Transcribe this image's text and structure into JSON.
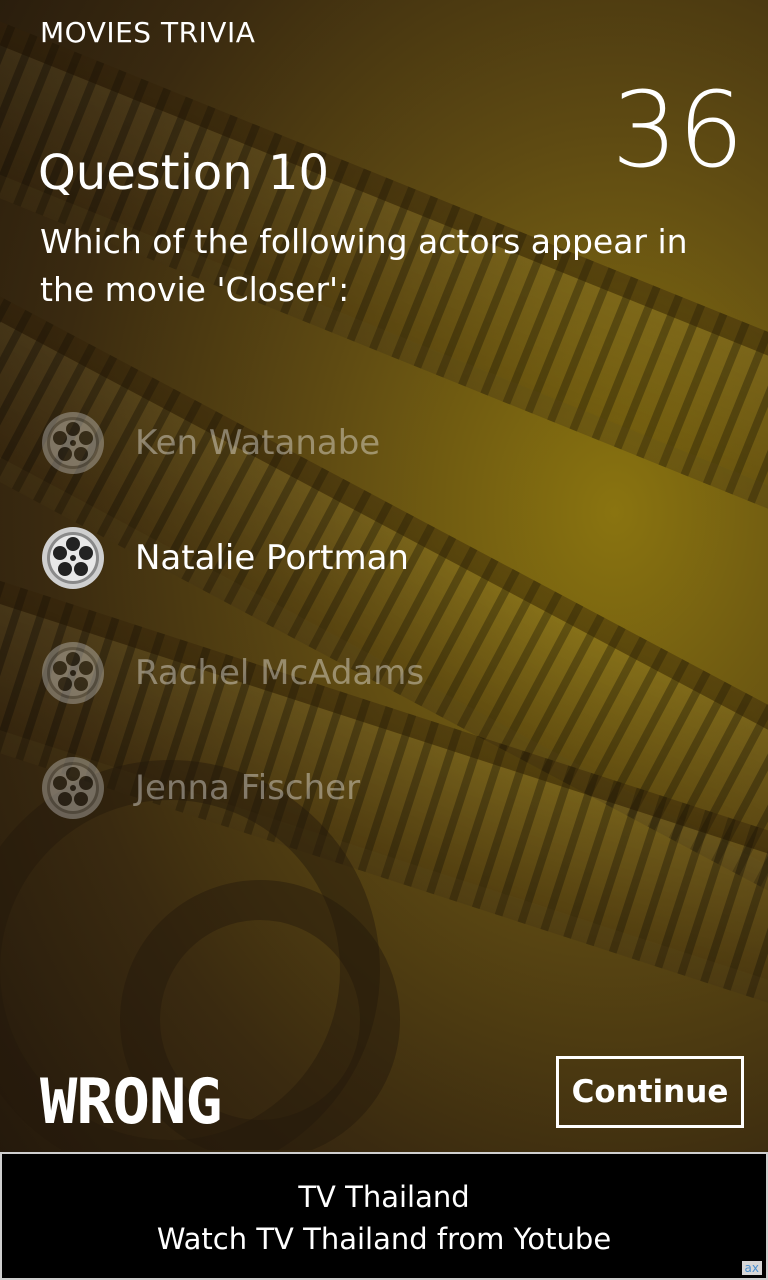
{
  "app": {
    "title": "MOVIES TRIVIA"
  },
  "timer": {
    "value": "36"
  },
  "question": {
    "title": "Question 10",
    "text": "Which of the following actors appear in the movie 'Closer':"
  },
  "options": [
    {
      "label": "Ken Watanabe",
      "state": "dimmed"
    },
    {
      "label": "Natalie Portman",
      "state": "selected"
    },
    {
      "label": "Rachel McAdams",
      "state": "dimmed"
    },
    {
      "label": "Jenna Fischer",
      "state": "dimmed"
    }
  ],
  "result": {
    "label": "WRONG"
  },
  "continue_button": {
    "label": "Continue"
  },
  "ad": {
    "title": "TV Thailand",
    "subtitle": "Watch TV Thailand from Yotube",
    "badge": "ax"
  },
  "icons": {
    "option_icon": "film-reel-icon"
  },
  "colors": {
    "accent": "#ffffff",
    "background": "#5e4a12",
    "ad_background": "#000000"
  }
}
